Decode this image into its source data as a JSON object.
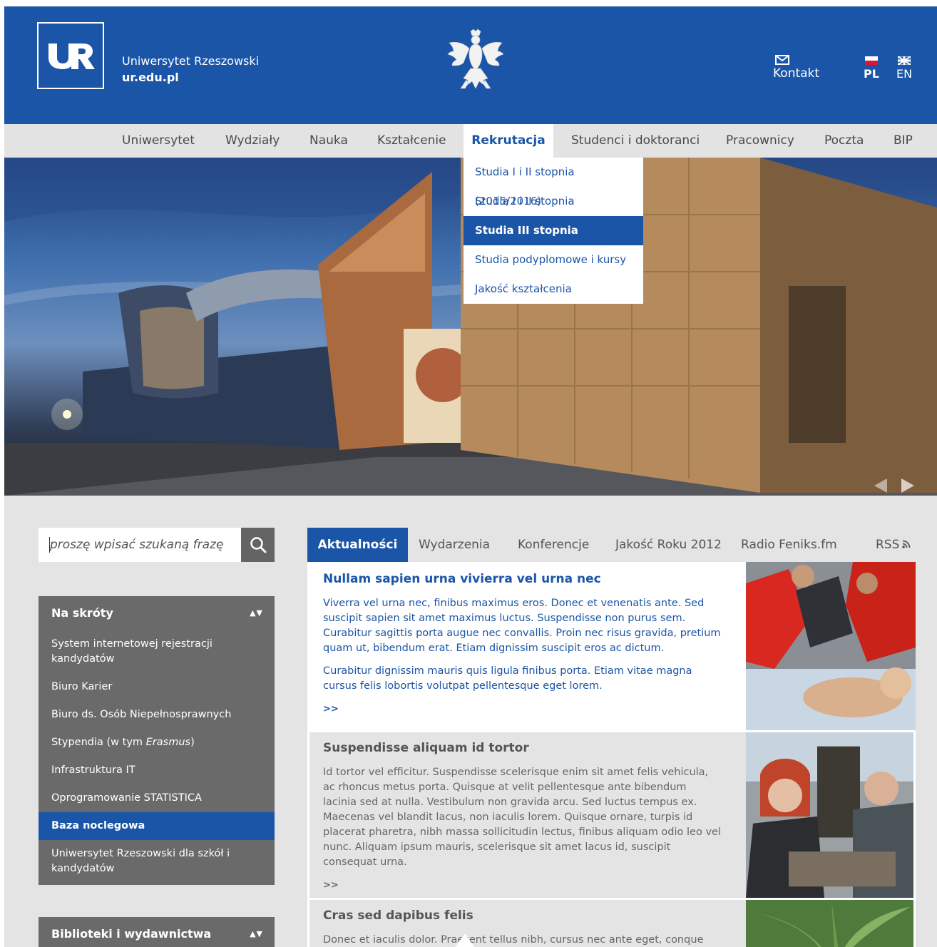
{
  "header": {
    "university_name": "Uniwersytet Rzeszowski",
    "university_url": "ur.edu.pl",
    "contact_label": "Kontakt",
    "languages": [
      {
        "code": "PL",
        "active": true
      },
      {
        "code": "EN",
        "active": false
      }
    ],
    "brand_color": "#1b55a7"
  },
  "nav": {
    "items": [
      {
        "label": "Uniwersytet"
      },
      {
        "label": "Wydziały"
      },
      {
        "label": "Nauka"
      },
      {
        "label": "Kształcenie"
      },
      {
        "label": "Rekrutacja",
        "active": true
      },
      {
        "label": "Studenci i doktoranci"
      },
      {
        "label": "Pracownicy"
      },
      {
        "label": "Poczta"
      },
      {
        "label": "BIP"
      }
    ]
  },
  "dropdown": {
    "items": [
      {
        "label": "Studia I i II stopnia (2015/2016)"
      },
      {
        "label": "Studia I i II stopnia"
      },
      {
        "label": "Studia III stopnia",
        "active": true
      },
      {
        "label": "Studia podyplomowe i kursy"
      },
      {
        "label": "Jakość kształcenia"
      }
    ]
  },
  "search": {
    "placeholder": "proszę wpisać szukaną frazę"
  },
  "shortcuts": {
    "title": "Na skróty",
    "toggle": "▲▼",
    "items": [
      {
        "label": "System internetowej rejestracji kandydatów"
      },
      {
        "label": "Biuro Karier"
      },
      {
        "label": "Biuro ds. Osób Niepełnosprawnych"
      },
      {
        "label_prefix": "Stypendia (w tym ",
        "label_em": "Erasmus",
        "label_suffix": ")"
      },
      {
        "label": "Infrastruktura IT"
      },
      {
        "label": "Oprogramowanie STATISTICA"
      },
      {
        "label": "Baza noclegowa",
        "active": true
      },
      {
        "label": "Uniwersytet Rzeszowski dla szkół i kandydatów"
      }
    ]
  },
  "libraries": {
    "title": "Biblioteki i wydawnictwa",
    "toggle": "▲▼"
  },
  "tabs": {
    "items": [
      {
        "label": "Aktualności",
        "active": true
      },
      {
        "label": "Wydarzenia"
      },
      {
        "label": "Konferencje"
      },
      {
        "label": "Jakość Roku 2012"
      },
      {
        "label": "Radio Feniks.fm"
      },
      {
        "label": "RSS"
      }
    ]
  },
  "news": [
    {
      "title": "Nullam sapien urna vivierra vel urna nec",
      "paragraphs": [
        "Viverra vel urna nec, finibus maximus eros. Donec et venenatis ante. Sed suscipit sapien sit amet maximus luctus. Suspendisse non purus sem. Curabitur sagittis porta augue nec convallis. Proin nec risus gravida, pretium quam ut, bibendum erat. Etiam dignissim suscipit eros ac dictum.",
        "Curabitur dignissim mauris quis ligula finibus porta. Etiam vitae magna cursus felis lobortis volutpat pellentesque eget lorem."
      ],
      "more": ">>"
    },
    {
      "title": "Suspendisse aliquam id tortor",
      "paragraphs": [
        "Id tortor vel efficitur. Suspendisse scelerisque enim sit amet felis vehicula, ac rhoncus metus porta. Quisque at velit pellentesque ante bibendum lacinia sed at nulla. Vestibulum non gravida arcu. Sed luctus tempus ex. Maecenas vel blandit lacus, non iaculis lorem. Quisque ornare, turpis id placerat pharetra, nibh massa sollicitudin lectus, finibus aliquam odio leo vel nunc. Aliquam ipsum mauris, scelerisque sit amet lacus id, suscipit consequat urna."
      ],
      "more": ">>"
    },
    {
      "title": "Cras sed dapibus felis",
      "paragraphs": [
        "Donec et iaculis dolor. Praesent tellus nibh, cursus nec ante eget, conque"
      ]
    }
  ]
}
